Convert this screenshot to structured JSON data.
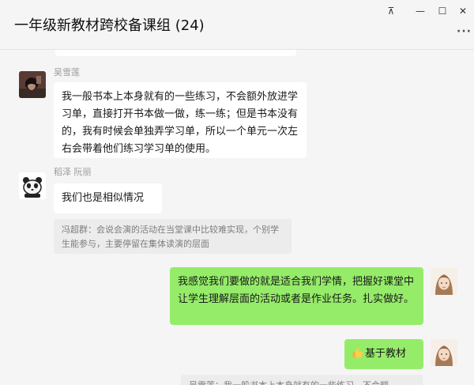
{
  "window": {
    "title": "一年级新教材跨校备课组 (24)",
    "pin_glyph": "⊼",
    "minimize_glyph": "—",
    "maximize_glyph": "☐",
    "close_glyph": "✕",
    "more_glyph": "···"
  },
  "messages": [
    {
      "sender": "吴雪莲",
      "text": "我一般书本上本身就有的一些练习，不会额外放进学习单，直接打开书本做一做，练一练；但是书本没有的，我有时候会单独弄学习单，所以一个单元一次左右会带着他们练习学习单的使用。"
    },
    {
      "sender": "稻泽 阮丽",
      "text": "我们也是相似情况",
      "quote": "冯超群：会说会演的活动在当堂课中比较难实现，个别学生能参与，主要停留在集体读演的层面"
    },
    {
      "text": "我感觉我们要做的就是适合我们学情，把握好课堂中让学生理解层面的活动或者是作业任务。扎实做好。"
    },
    {
      "text": "基于教材",
      "icon": "thumbs-up-icon",
      "quote_partial": "吴雪莲：我一般书本上本身就有的一些练习，不会额"
    }
  ],
  "colors": {
    "background": "#f5f5f5",
    "self_bubble": "#95ec69",
    "other_bubble": "#ffffff",
    "quote_bg": "#ececec"
  }
}
